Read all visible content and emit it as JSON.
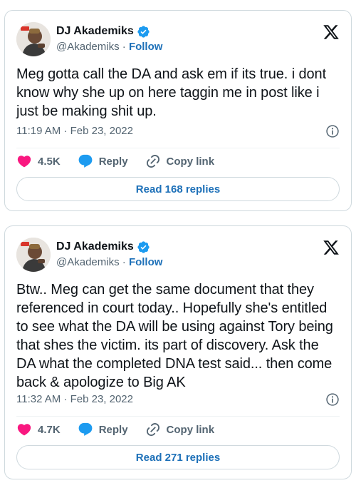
{
  "tweets": [
    {
      "author": {
        "display_name": "DJ Akademiks",
        "handle": "@Akademiks",
        "separator": " · ",
        "follow_label": "Follow"
      },
      "text": "Meg gotta call the DA and ask em if its true. i dont know why she up on here taggin me in post like i just be making shit up.",
      "timestamp": "11:19 AM · Feb 23, 2022",
      "likes": "4.5K",
      "reply_label": "Reply",
      "copy_link_label": "Copy link",
      "read_replies_label": "Read 168 replies"
    },
    {
      "author": {
        "display_name": "DJ Akademiks",
        "handle": "@Akademiks",
        "separator": " · ",
        "follow_label": "Follow"
      },
      "text": "Btw.. Meg can get the same document that they referenced in court today.. Hopefully she's entitled to see what the DA will be using against Tory being that shes the victim. its part of discovery. Ask the DA what the completed DNA test said... then come back & apologize to Big AK",
      "timestamp": "11:32 AM · Feb 23, 2022",
      "likes": "4.7K",
      "reply_label": "Reply",
      "copy_link_label": "Copy link",
      "read_replies_label": "Read 271 replies"
    }
  ],
  "icons": {
    "verified": "verified-badge-icon",
    "brand": "x-logo-icon",
    "info": "info-icon",
    "like": "heart-icon",
    "reply": "speech-bubble-icon",
    "copy": "link-icon"
  },
  "colors": {
    "heart": "#f91880",
    "reply": "#1d9bf0",
    "verified": "#1d9bf0",
    "link": "#1d70b8",
    "muted": "#536471",
    "border": "#cfd9de"
  }
}
